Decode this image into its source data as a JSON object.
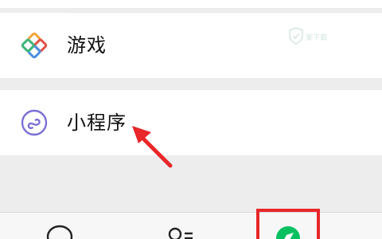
{
  "menu": {
    "items": [
      {
        "label": "游戏",
        "icon": "games-icon"
      },
      {
        "label": "小程序",
        "icon": "mini-programs-icon"
      }
    ]
  },
  "watermark": {
    "text": "爱下载"
  },
  "annotation": {
    "arrow_color": "#e8272a",
    "box_color": "#e8272a"
  },
  "tabbar": {
    "tabs": [
      {
        "icon": "chat-bubble-icon"
      },
      {
        "icon": "contacts-icon"
      },
      {
        "icon": "discover-compass-icon",
        "active": true
      }
    ]
  },
  "colors": {
    "background": "#ededed",
    "row": "#ffffff",
    "accent": "#07c160"
  }
}
